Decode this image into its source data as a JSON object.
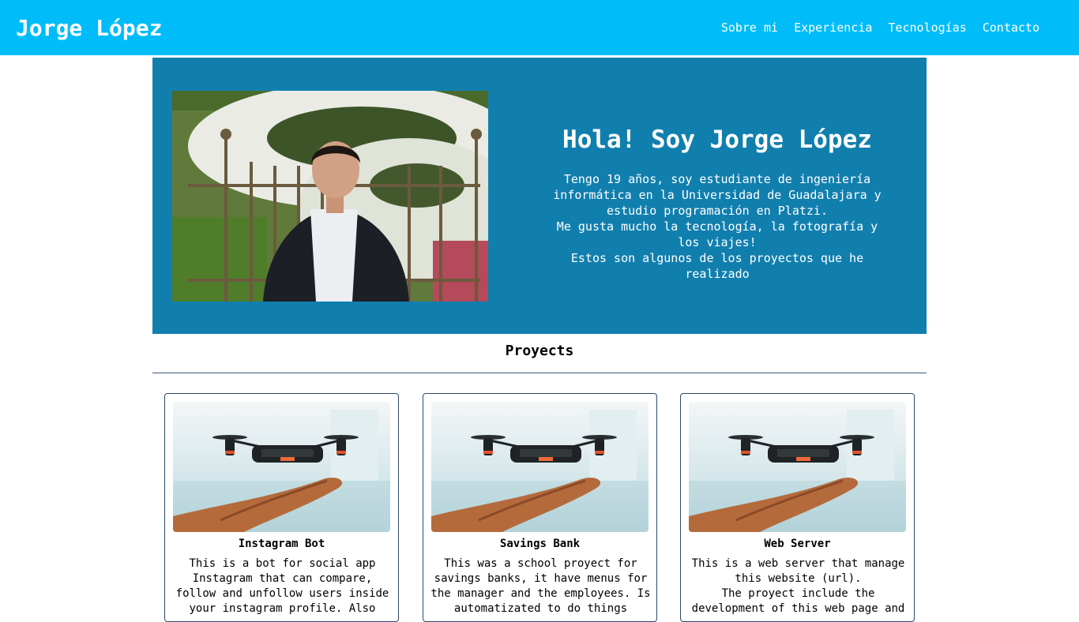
{
  "header": {
    "brand": "Jorge López",
    "nav": [
      "Sobre mi",
      "Experiencia",
      "Tecnologías",
      "Contacto"
    ]
  },
  "hero": {
    "title": "Hola! Soy Jorge López",
    "lines": [
      "Tengo 19 años, soy estudiante de ingeniería informática en la Universidad de Guadalajara y estudio programación en Platzi.",
      "Me gusta mucho la tecnología, la fotografía y los viajes!",
      "Estos son algunos de los proyectos que he realizado"
    ]
  },
  "projects": {
    "heading": "Proyects",
    "cards": [
      {
        "title": "Instagram Bot",
        "lines": [
          "This is a bot for social app Instagram that can compare, follow and unfollow users inside your instagram profile. Also"
        ]
      },
      {
        "title": "Savings Bank",
        "lines": [
          "This was a school proyect for savings banks, it have menus for the manager and the employees. Is automatizated to do things"
        ]
      },
      {
        "title": "Web Server",
        "lines": [
          "This is a web server that manage this website (url).",
          "The proyect include the development of this web page and"
        ]
      }
    ]
  },
  "colors": {
    "navbar": "#00bcf9",
    "hero": "#117fad",
    "card_border": "#2b4a6b"
  }
}
